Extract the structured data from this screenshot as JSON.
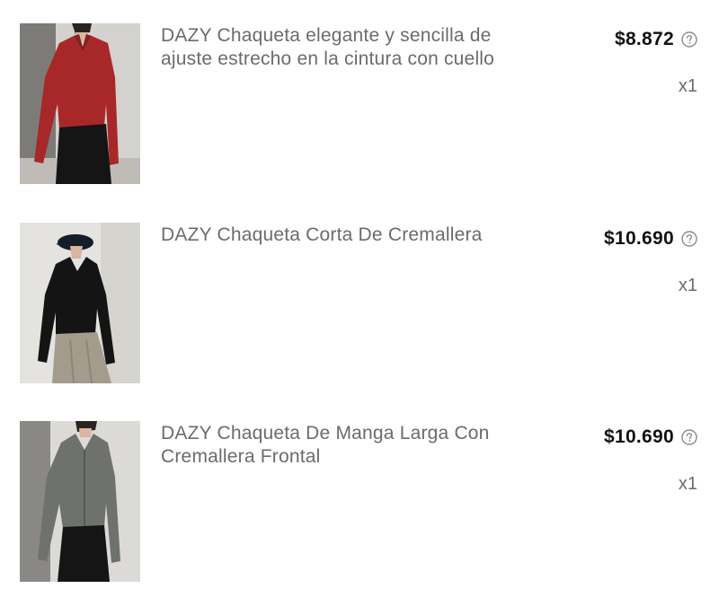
{
  "items": [
    {
      "title_line1": "DAZY Chaqueta elegante y sencilla de",
      "title_line2": "ajuste estrecho en la cintura con cuello",
      "price": "$8.872",
      "quantity": "x1",
      "garment_color": "#a8282a",
      "pants_color": "#151515"
    },
    {
      "title_line1": "DAZY Chaqueta Corta De Cremallera",
      "title_line2": "",
      "price": "$10.690",
      "quantity": "x1",
      "garment_color": "#141414",
      "pants_color": "#a39c8c"
    },
    {
      "title_line1": "DAZY Chaqueta De Manga Larga Con",
      "title_line2": "Cremallera Frontal",
      "price": "$10.690",
      "quantity": "x1",
      "garment_color": "#6f716e",
      "pants_color": "#151515"
    }
  ],
  "help_icon": "question-circle-icon"
}
